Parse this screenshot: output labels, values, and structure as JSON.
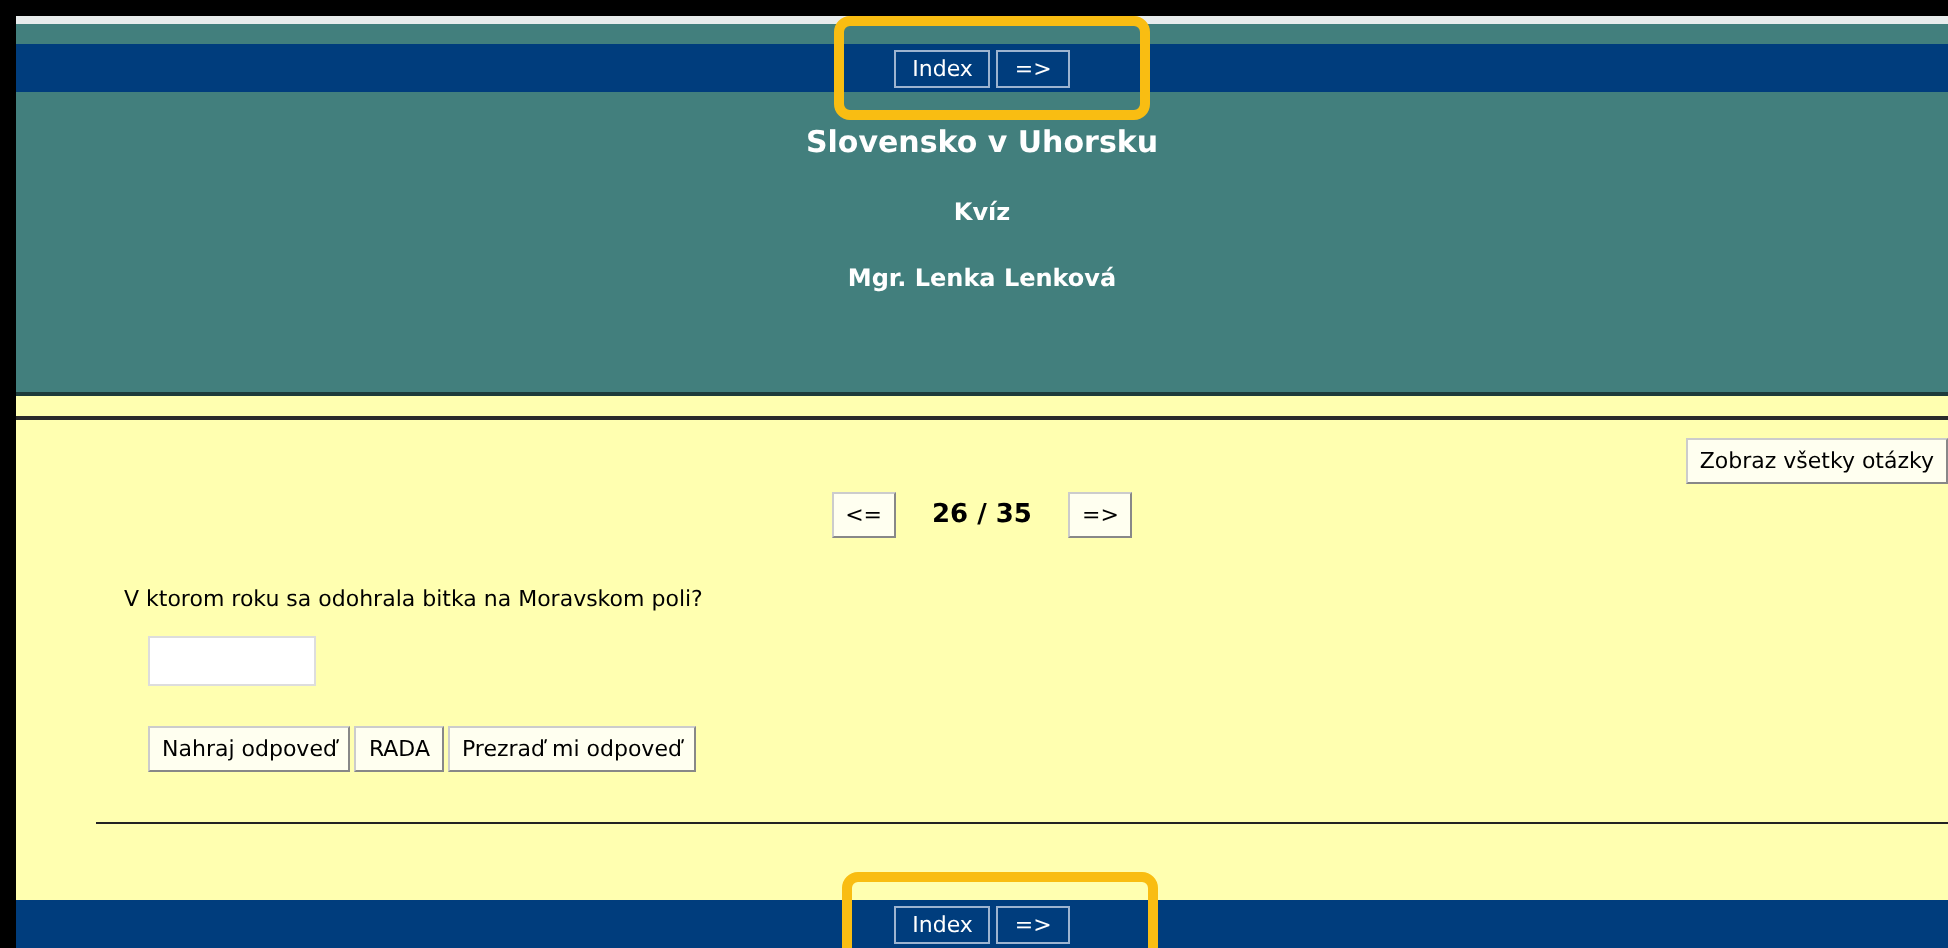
{
  "top_nav": {
    "highlighted": true,
    "buttons": [
      "Index",
      "=>"
    ]
  },
  "header": {
    "title": "Slovensko v Uhorsku",
    "subtitle": "Kvíz",
    "author": "Mgr. Lenka Lenková"
  },
  "show_all_button": "Zobraz všetky otázky",
  "pager": {
    "prev": "<=",
    "position": "26 / 35",
    "next": "=>"
  },
  "question": "V ktorom roku sa odohrala bitka na Moravskom poli?",
  "actions": [
    "Nahraj odpoveď",
    "RADA",
    "Prezraď mi odpoveď"
  ],
  "bottom_nav": {
    "highlighted": true,
    "buttons": [
      "Index",
      "=>"
    ]
  }
}
